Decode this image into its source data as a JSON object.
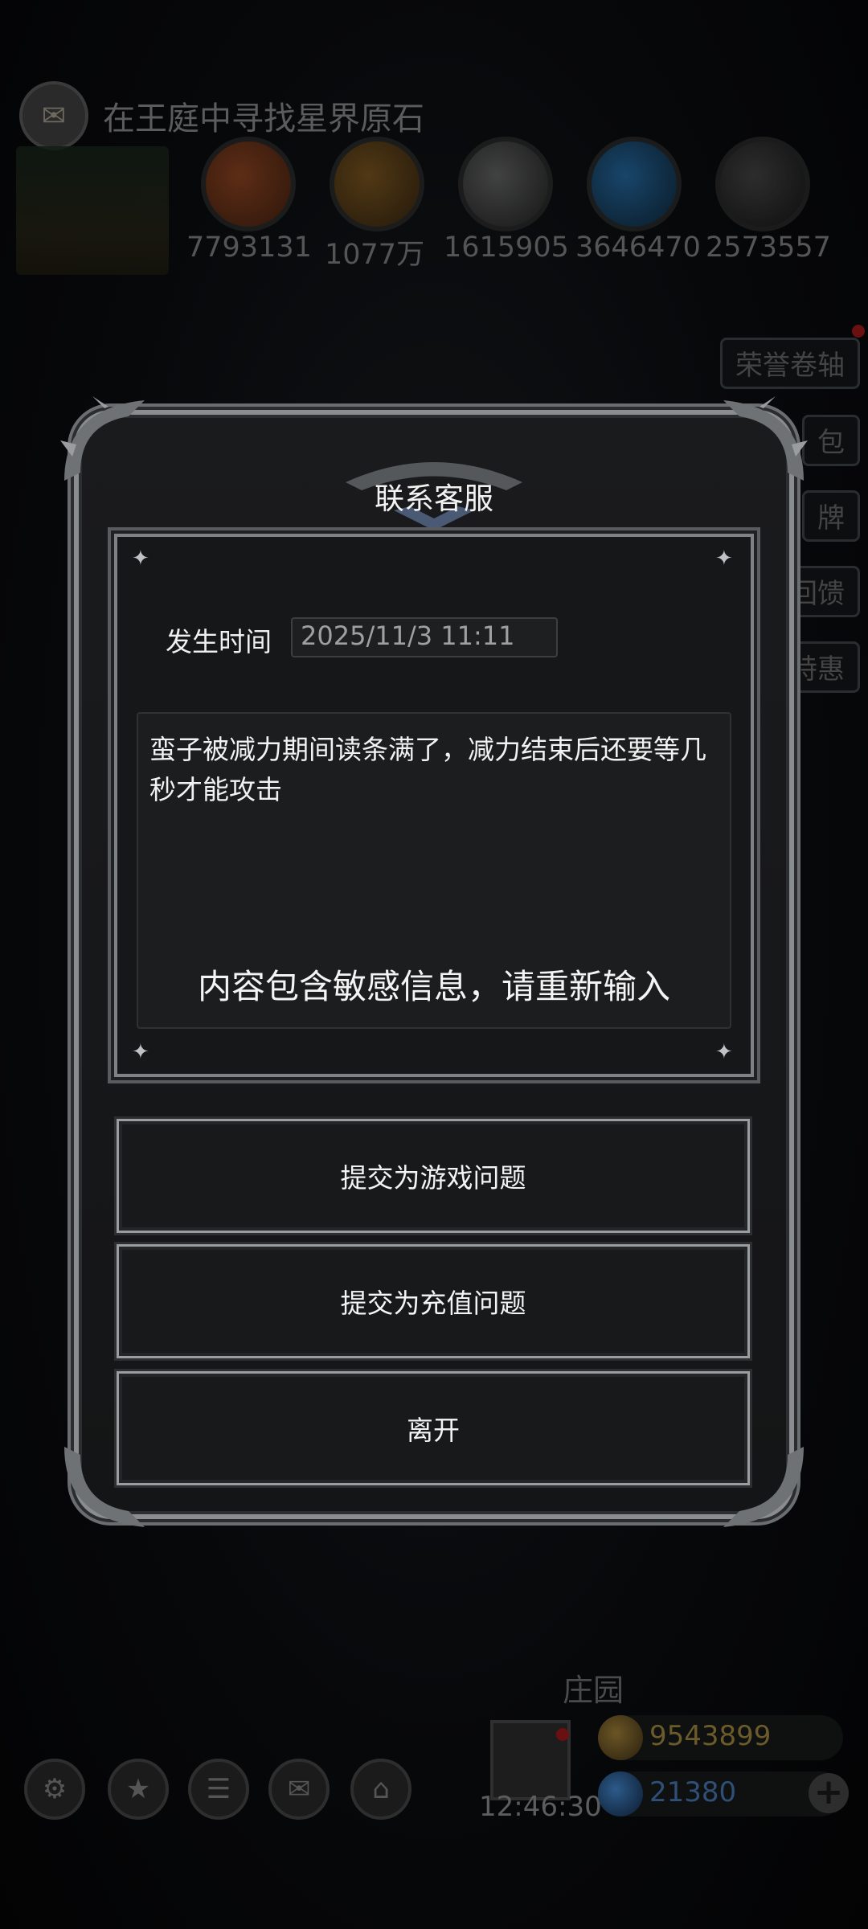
{
  "quest": {
    "text": "在王庭中寻找星界原石"
  },
  "resources": [
    {
      "icon": "copper-ore-icon",
      "value": "7793131"
    },
    {
      "icon": "wood-log-icon",
      "value": "1077万"
    },
    {
      "icon": "iron-bar-icon",
      "value": "1615905"
    },
    {
      "icon": "crystal-icon",
      "value": "3646470"
    },
    {
      "icon": "stone-icon",
      "value": "2573557"
    }
  ],
  "side_menu": {
    "honor_scroll": "荣誉卷轴",
    "bag": "包",
    "card": "牌",
    "feedback": "回馈",
    "special": "特惠"
  },
  "dialog": {
    "title": "联系客服",
    "time_label": "发生时间",
    "time_value": "2025/11/3 11:11",
    "content_text": "蛮子被减力期间读条满了，减力结束后还要等几秒才能攻击",
    "warning_text": "内容包含敏感信息，请重新输入",
    "buttons": {
      "submit_game": "提交为游戏问题",
      "submit_recharge": "提交为充值问题",
      "leave": "离开"
    }
  },
  "bottom_bar": {
    "icons": [
      "settings-gear-icon",
      "star-badge-icon",
      "ranking-icon",
      "mail-icon",
      "shop-bag-icon"
    ],
    "estate_label": "庄园",
    "clock": "12:46:30",
    "gold_value": "9543899",
    "gem_value": "21380"
  },
  "colors": {
    "gold_text": "#6b5a2a",
    "gem_text": "#2f4f77",
    "dialog_frame": "#8a8d90"
  }
}
